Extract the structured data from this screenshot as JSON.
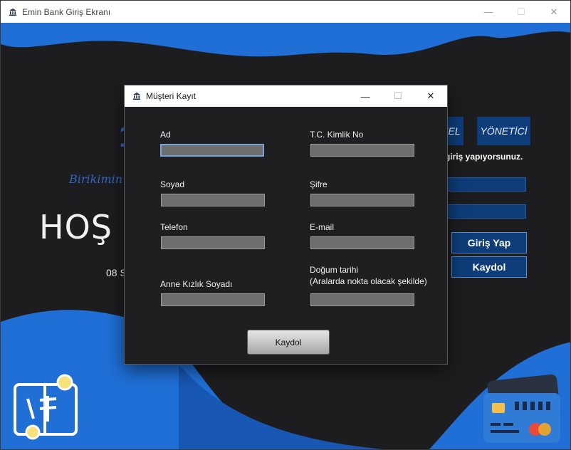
{
  "main_window": {
    "title": "Emin Bank Giriş Ekranı",
    "controls": {
      "minimize": "—",
      "maximize": "☐",
      "close": "✕"
    }
  },
  "background": {
    "tabs": [
      {
        "label": "NEL"
      },
      {
        "label": "YÖNETİCİ"
      }
    ],
    "notice": "giriş yapıyorsunuz.",
    "login_button": "Giriş Yap",
    "register_button": "Kaydol",
    "slogan": "Birikimin",
    "welcome": "HOŞ G",
    "date": "08 S",
    "logo_glyph": "1"
  },
  "dialog": {
    "title": "Müşteri Kayıt",
    "controls": {
      "minimize": "—",
      "maximize": "☐",
      "close": "✕"
    },
    "fields": {
      "ad": {
        "label": "Ad",
        "value": ""
      },
      "tc": {
        "label": "T.C. Kimlik No",
        "value": ""
      },
      "soyad": {
        "label": "Soyad",
        "value": ""
      },
      "sifre": {
        "label": "Şifre",
        "value": ""
      },
      "telefon": {
        "label": "Telefon",
        "value": ""
      },
      "email": {
        "label": "E-mail",
        "value": ""
      },
      "anne": {
        "label": "Anne Kızlık Soyadı",
        "value": ""
      },
      "dogum": {
        "label_line1": "Doğum tarihi",
        "label_line2": "(Aralarda nokta olacak şekilde)",
        "value": ""
      }
    },
    "submit_label": "Kaydol"
  },
  "colors": {
    "brand_blue": "#1f6fd6",
    "dark_bg": "#1d1d20",
    "button_blue": "#0e3d7a"
  }
}
